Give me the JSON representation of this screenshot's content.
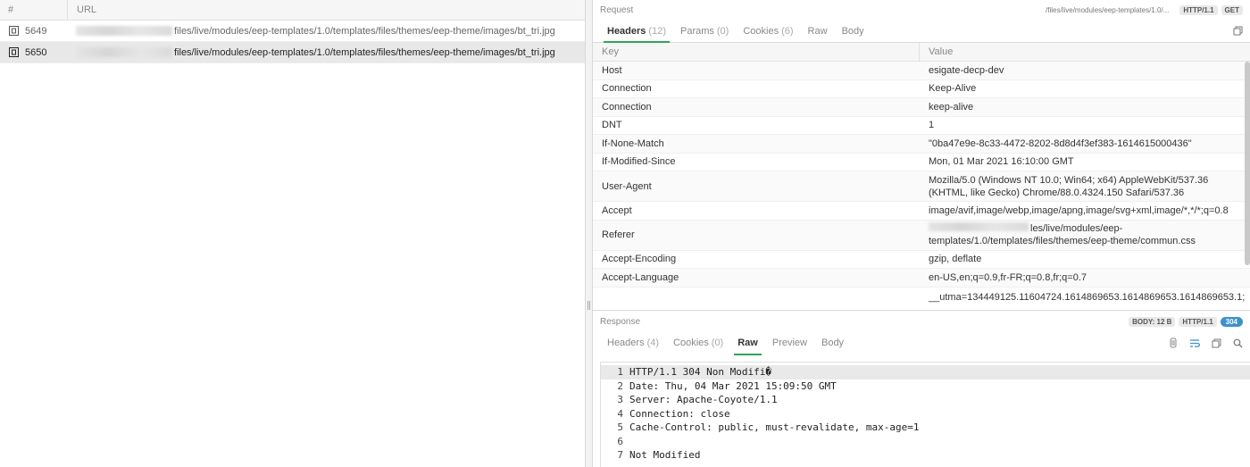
{
  "list": {
    "headers": {
      "num": "#",
      "url": "URL"
    },
    "rows": [
      {
        "id": "5649",
        "url": "files/live/modules/eep-templates/1.0/templates/files/themes/eep-theme/images/bt_tri.jpg",
        "selected": false
      },
      {
        "id": "5650",
        "url": "files/live/modules/eep-templates/1.0/templates/files/themes/eep-theme/images/bt_tri.jpg",
        "selected": true
      }
    ]
  },
  "request": {
    "title": "Request",
    "url_truncated": "/files/live/modules/eep-templates/1.0/...",
    "protocol": "HTTP/1.1",
    "method": "GET",
    "tabs": [
      {
        "label": "Headers",
        "count": "(12)"
      },
      {
        "label": "Params",
        "count": "(0)"
      },
      {
        "label": "Cookies",
        "count": "(6)"
      },
      {
        "label": "Raw",
        "count": ""
      },
      {
        "label": "Body",
        "count": ""
      }
    ],
    "table": {
      "col_key": "Key",
      "col_value": "Value",
      "rows": [
        {
          "key": "Host",
          "value": "esigate-decp-dev"
        },
        {
          "key": "Connection",
          "value": "Keep-Alive"
        },
        {
          "key": "Connection",
          "value": "keep-alive"
        },
        {
          "key": "DNT",
          "value": "1"
        },
        {
          "key": "If-None-Match",
          "value": "\"0ba47e9e-8c33-4472-8202-8d8d4f3ef383-1614615000436\""
        },
        {
          "key": "If-Modified-Since",
          "value": "Mon, 01 Mar 2021 16:10:00 GMT"
        },
        {
          "key": "User-Agent",
          "value": "Mozilla/5.0 (Windows NT 10.0; Win64; x64) AppleWebKit/537.36 (KHTML, like Gecko) Chrome/88.0.4324.150 Safari/537.36"
        },
        {
          "key": "Accept",
          "value": "image/avif,image/webp,image/apng,image/svg+xml,image/*,*/*;q=0.8"
        },
        {
          "key": "Referer",
          "value": "les/live/modules/eep-templates/1.0/templates/files/themes/eep-theme/commun.css"
        },
        {
          "key": "Accept-Encoding",
          "value": "gzip, deflate"
        },
        {
          "key": "Accept-Language",
          "value": "en-US,en;q=0.9,fr-FR;q=0.8,fr;q=0.7"
        },
        {
          "key": "",
          "value": "__utma=134449125.11604724.1614869653.1614869653.1614869653.1;"
        }
      ]
    }
  },
  "response": {
    "title": "Response",
    "body_size": "BODY: 12 B",
    "protocol": "HTTP/1.1",
    "status": "304",
    "tabs": [
      {
        "label": "Headers",
        "count": "(4)"
      },
      {
        "label": "Cookies",
        "count": "(0)"
      },
      {
        "label": "Raw",
        "count": ""
      },
      {
        "label": "Preview",
        "count": ""
      },
      {
        "label": "Body",
        "count": ""
      }
    ],
    "raw_lines": [
      "HTTP/1.1 304 Non Modifi�",
      "Date: Thu, 04 Mar 2021 15:09:50 GMT",
      "Server: Apache-Coyote/1.1",
      "Connection: close",
      "Cache-Control: public, must-revalidate, max-age=1",
      "",
      "Not Modified"
    ]
  },
  "icons": {
    "request_icon": "page-icon",
    "copy": "copy-icon",
    "search": "search-icon"
  }
}
